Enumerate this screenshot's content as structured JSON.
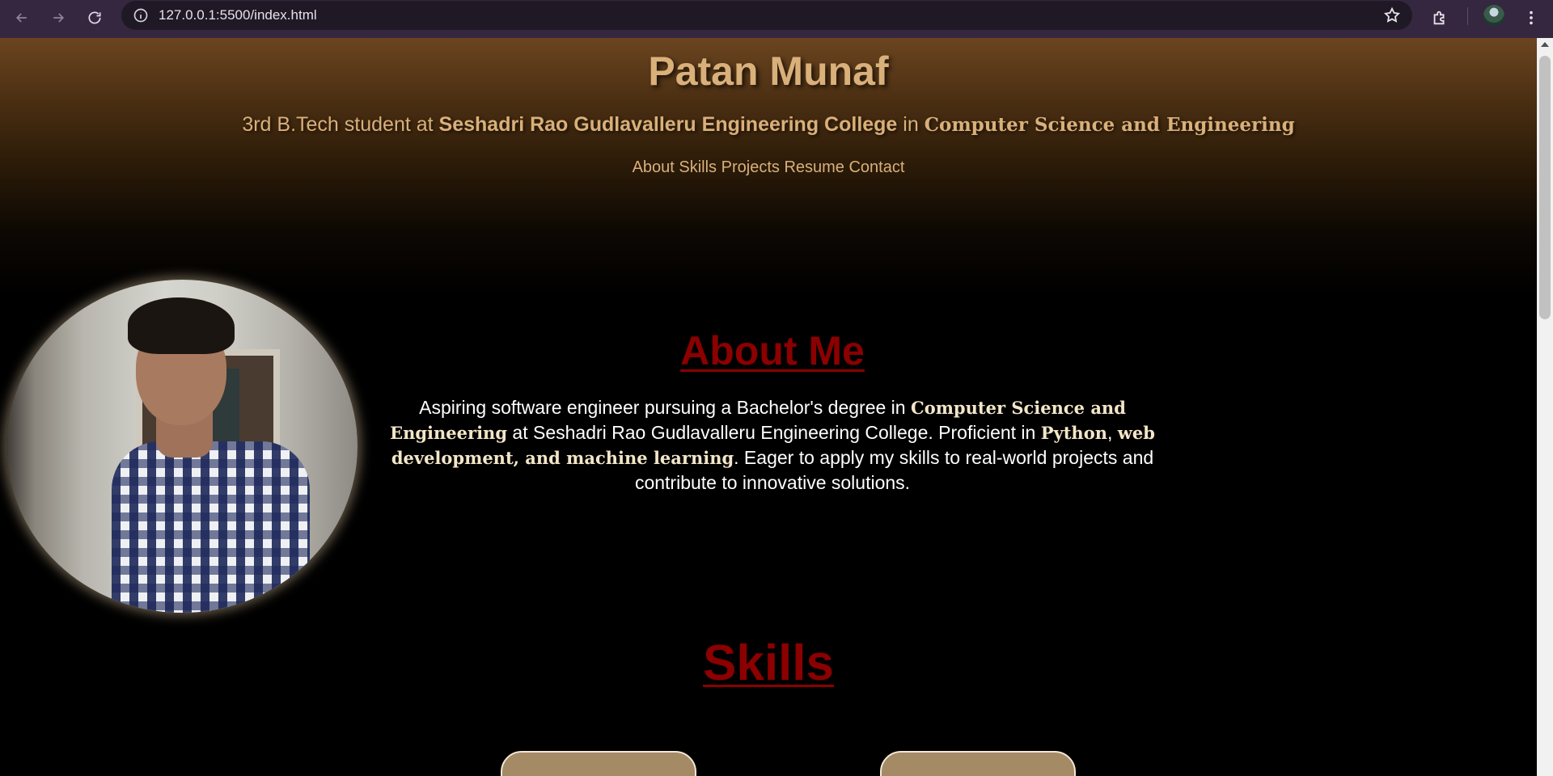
{
  "browser": {
    "url": "127.0.0.1:5500/index.html",
    "icons": [
      "back-icon",
      "forward-icon",
      "reload-icon",
      "site-info-icon",
      "bookmark-star-icon",
      "extensions-icon",
      "profile-avatar",
      "menu-icon"
    ]
  },
  "header": {
    "name": "Patan Munaf",
    "tagline": {
      "prefix": "3rd B.Tech student at ",
      "college": "Seshadri Rao Gudlavalleru Engineering College",
      "middle": " in ",
      "branch": "Computer Science and Engineering"
    },
    "nav": [
      "About",
      "Skills",
      "Projects",
      "Resume",
      "Contact"
    ]
  },
  "about": {
    "title": "About Me",
    "text_1": "Aspiring software engineer pursuing a Bachelor's degree in ",
    "hl_1": "Computer Science and Engineering",
    "text_2": " at Seshadri Rao Gudlavalleru Engineering College. Proficient in ",
    "hl_2": "Python",
    "text_3": ", ",
    "hl_3": "web development, and machine learning",
    "text_4": ". Eager to apply my skills to real-world projects and contribute to innovative solutions."
  },
  "skills": {
    "title": "Skills"
  },
  "colors": {
    "accent_gold": "#d9b07a",
    "heading_red": "#8b0000",
    "card_tan": "#a58a66"
  }
}
